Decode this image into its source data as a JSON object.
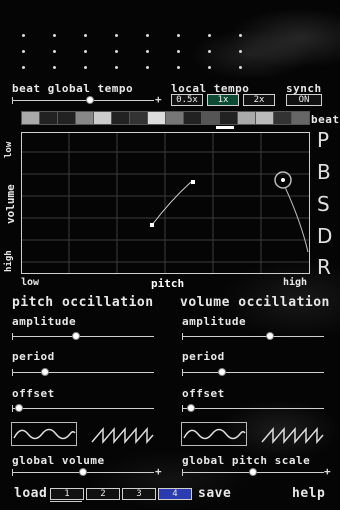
{
  "header": {
    "beat_global_tempo": "beat global tempo",
    "local_tempo": "local tempo",
    "synch": "synch",
    "tempo_options": [
      "0.5x",
      "1x",
      "2x"
    ],
    "selected_tempo": "1x",
    "synch_state": "ON",
    "beat_label": "beat",
    "beat_pattern": [
      "#aaaaaa",
      "#222222",
      "#222222",
      "#888888",
      "#cccccc",
      "#222222",
      "#333333",
      "#dddddd",
      "#777777",
      "#222222",
      "#555555",
      "#222222",
      "#aaaaaa",
      "#bbbbbb",
      "#333333",
      "#666666"
    ]
  },
  "side_letters": [
    "P",
    "B",
    "S",
    "D",
    "R"
  ],
  "pad": {
    "y_low": "low",
    "y_label": "volume",
    "y_high": "high",
    "x_low": "low",
    "x_label": "pitch",
    "x_high": "high"
  },
  "pitch_osc": {
    "title": "pitch occillation",
    "amplitude": "amplitude",
    "period": "period",
    "offset": "offset",
    "amplitude_value": 0.45,
    "period_value": 0.23,
    "offset_value": 0.05
  },
  "volume_osc": {
    "title": "volume occillation",
    "amplitude": "amplitude",
    "period": "period",
    "offset": "offset",
    "amplitude_value": 0.62,
    "period_value": 0.28,
    "offset_value": 0.06
  },
  "global": {
    "volume": "global volume",
    "pitch_scale": "global pitch scale",
    "volume_value": 0.5,
    "pitch_scale_value": 0.5
  },
  "footer": {
    "load": "load",
    "slots": [
      "1",
      "2",
      "3",
      "4"
    ],
    "selected_slot": "4",
    "save": "save",
    "help": "help"
  },
  "colors": {
    "accent_green": "#0d4a34",
    "accent_blue": "#2a3cb0"
  }
}
